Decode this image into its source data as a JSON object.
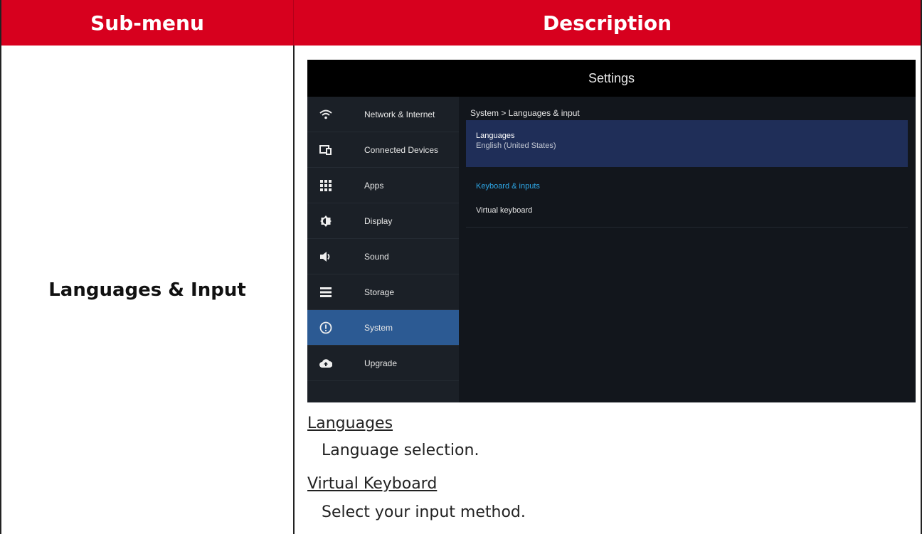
{
  "table": {
    "header_submenu": "Sub-menu",
    "header_description": "Description",
    "submenu_label": "Languages & Input"
  },
  "screen": {
    "title": "Settings",
    "sidebar": [
      {
        "label": "Network & Internet",
        "icon": "wifi-icon",
        "glyph": "ᯤ"
      },
      {
        "label": "Connected Devices",
        "icon": "devices-icon",
        "glyph": "⧉"
      },
      {
        "label": "Apps",
        "icon": "apps-grid-icon",
        "glyph": "⋮⋮⋮"
      },
      {
        "label": "Display",
        "icon": "brightness-icon",
        "glyph": "◐"
      },
      {
        "label": "Sound",
        "icon": "speaker-icon",
        "glyph": "🔈"
      },
      {
        "label": "Storage",
        "icon": "storage-icon",
        "glyph": "☰"
      },
      {
        "label": "System",
        "icon": "info-circle-icon",
        "glyph": "ⓘ",
        "active": true
      },
      {
        "label": "Upgrade",
        "icon": "cloud-upload-icon",
        "glyph": "☁"
      }
    ],
    "breadcrumb": "System > Languages & input",
    "languages_title": "Languages",
    "languages_value": "English (United States)",
    "keyboard_header": "Keyboard & inputs",
    "virtual_keyboard": "Virtual keyboard",
    "colors": {
      "active": "#2c5a93",
      "selected_row": "#1f2e58",
      "accent": "#2ea8e8",
      "header_red": "#d7001e"
    }
  },
  "description": {
    "languages_heading": "Languages",
    "languages_text": "Language selection.",
    "vk_heading": "Virtual Keyboard",
    "vk_text": "Select your input method."
  }
}
